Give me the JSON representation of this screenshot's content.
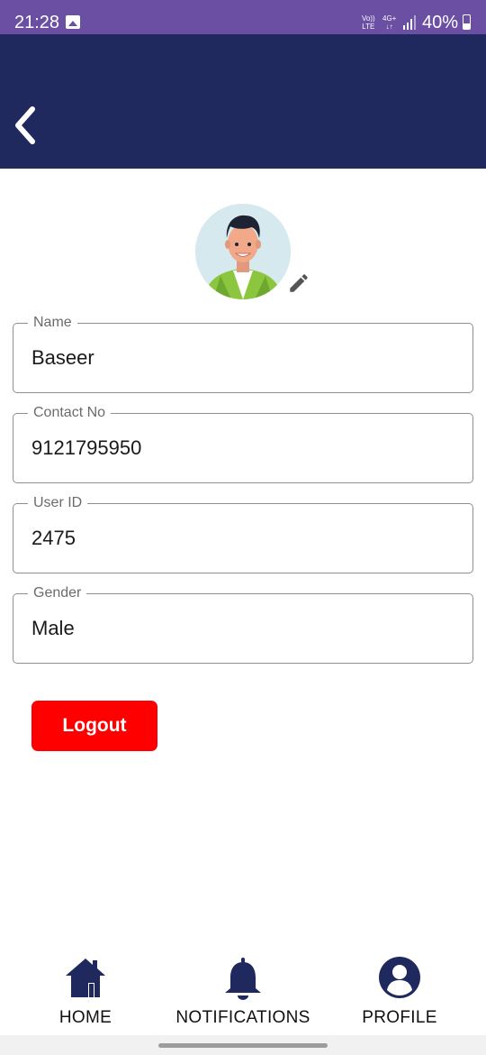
{
  "status_bar": {
    "time": "21:28",
    "volte_top": "Vo))",
    "volte_bottom": "LTE",
    "network_top": "4G+",
    "network_bottom": "↓↑",
    "battery_text": "40%",
    "battery_level": 0.4,
    "icons": [
      "gallery-icon",
      "signal-icon",
      "battery-icon"
    ],
    "background_color": "#6a4fa3"
  },
  "header": {
    "background_color": "#1f295e",
    "back_icon": "chevron-left-icon"
  },
  "profile": {
    "avatar_icon": "avatar-illustration",
    "edit_icon": "pencil-icon",
    "fields": [
      {
        "label": "Name",
        "value": "Baseer"
      },
      {
        "label": "Contact No",
        "value": "9121795950"
      },
      {
        "label": "User ID",
        "value": "2475"
      },
      {
        "label": "Gender",
        "value": "Male"
      }
    ]
  },
  "logout": {
    "label": "Logout",
    "color": "#ff0000"
  },
  "bottom_nav": {
    "icon_color": "#1f295e",
    "items": [
      {
        "label": "HOME",
        "icon": "home-icon"
      },
      {
        "label": "NOTIFICATIONS",
        "icon": "bell-icon"
      },
      {
        "label": "PROFILE",
        "icon": "user-circle-icon"
      }
    ]
  }
}
